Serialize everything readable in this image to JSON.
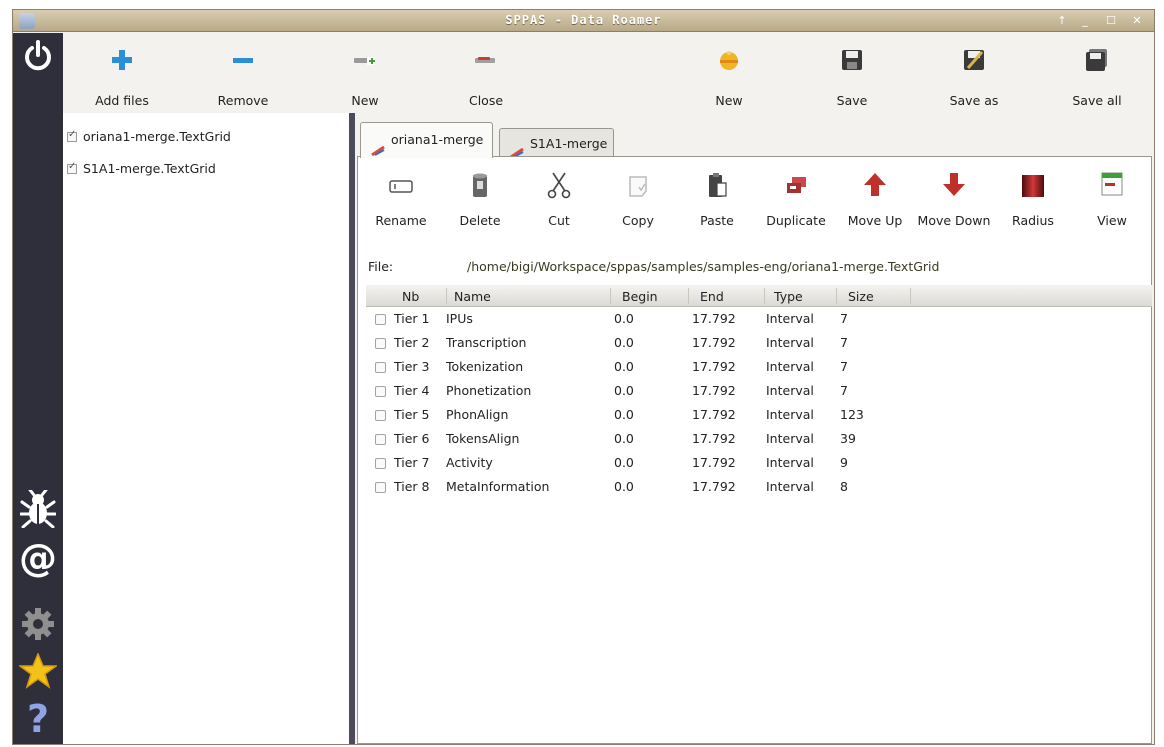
{
  "window": {
    "title": "SPPAS - Data Roamer",
    "controls": [
      "↑",
      "_",
      "☐",
      "✕"
    ]
  },
  "sidebar": {
    "top_icon": "power-icon",
    "bottom_icons": [
      "bug-icon",
      "at-icon",
      "gear-icon",
      "star-icon",
      "help-icon"
    ]
  },
  "toolbar": {
    "items": [
      {
        "label": "Add files",
        "icon": "plus-icon",
        "color": "#2b8fd8"
      },
      {
        "label": "Remove",
        "icon": "minus-icon",
        "color": "#2b8fd8"
      },
      {
        "label": "New",
        "icon": "new-file-icon",
        "color": "#3aa03a"
      },
      {
        "label": "Close",
        "icon": "close-file-icon",
        "color": "#cc3b2f"
      },
      {
        "label": "New",
        "icon": "new-workspace-icon",
        "color": "#e3a21a"
      },
      {
        "label": "Save",
        "icon": "save-icon",
        "color": "#3a3a3a"
      },
      {
        "label": "Save as",
        "icon": "save-as-icon",
        "color": "#3a3a3a"
      },
      {
        "label": "Save all",
        "icon": "save-all-icon",
        "color": "#3a3a3a"
      }
    ]
  },
  "files": [
    {
      "name": "oriana1-merge.TextGrid",
      "checked": true
    },
    {
      "name": "S1A1-merge.TextGrid",
      "checked": true
    }
  ],
  "tabs": [
    {
      "label": "oriana1-merge",
      "active": true
    },
    {
      "label": "S1A1-merge",
      "active": false
    }
  ],
  "actions": [
    {
      "label": "Rename",
      "icon": "rename-icon"
    },
    {
      "label": "Delete",
      "icon": "trash-icon"
    },
    {
      "label": "Cut",
      "icon": "scissors-icon"
    },
    {
      "label": "Copy",
      "icon": "copy-icon"
    },
    {
      "label": "Paste",
      "icon": "paste-icon"
    },
    {
      "label": "Duplicate",
      "icon": "duplicate-icon"
    },
    {
      "label": "Move Up",
      "icon": "arrow-up-icon"
    },
    {
      "label": "Move Down",
      "icon": "arrow-down-icon"
    },
    {
      "label": "Radius",
      "icon": "radius-icon"
    },
    {
      "label": "View",
      "icon": "view-icon"
    }
  ],
  "file_label": "File:",
  "file_path": "/home/bigi/Workspace/sppas/samples/samples-eng/oriana1-merge.TextGrid",
  "table": {
    "headers": [
      "Nb",
      "Name",
      "Begin",
      "End",
      "Type",
      "Size"
    ],
    "rows": [
      {
        "nb": "Tier 1",
        "name": "IPUs",
        "begin": "0.0",
        "end": "17.792",
        "type": "Interval",
        "size": "7"
      },
      {
        "nb": "Tier 2",
        "name": "Transcription",
        "begin": "0.0",
        "end": "17.792",
        "type": "Interval",
        "size": "7"
      },
      {
        "nb": "Tier 3",
        "name": "Tokenization",
        "begin": "0.0",
        "end": "17.792",
        "type": "Interval",
        "size": "7"
      },
      {
        "nb": "Tier 4",
        "name": "Phonetization",
        "begin": "0.0",
        "end": "17.792",
        "type": "Interval",
        "size": "7"
      },
      {
        "nb": "Tier 5",
        "name": "PhonAlign",
        "begin": "0.0",
        "end": "17.792",
        "type": "Interval",
        "size": "123"
      },
      {
        "nb": "Tier 6",
        "name": "TokensAlign",
        "begin": "0.0",
        "end": "17.792",
        "type": "Interval",
        "size": "39"
      },
      {
        "nb": "Tier 7",
        "name": "Activity",
        "begin": "0.0",
        "end": "17.792",
        "type": "Interval",
        "size": "9"
      },
      {
        "nb": "Tier 8",
        "name": "MetaInformation",
        "begin": "0.0",
        "end": "17.792",
        "type": "Interval",
        "size": "8"
      }
    ]
  }
}
